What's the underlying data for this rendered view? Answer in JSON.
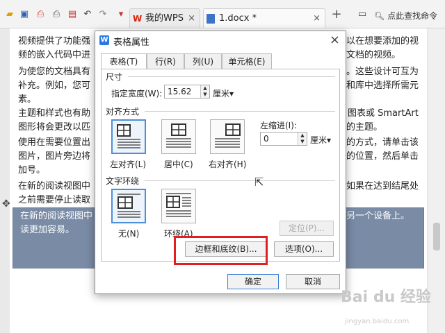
{
  "toolbar": {
    "icons": [
      "open-folder-icon",
      "save-icon",
      "print-preview-icon",
      "print-icon",
      "export-pdf-icon",
      "undo-icon",
      "redo-icon",
      "dropdown-icon"
    ],
    "tabs": [
      {
        "label": "我的WPS",
        "close": "×"
      },
      {
        "label": "1.docx *",
        "close": "×"
      }
    ],
    "new_tab": "+",
    "find_label": "点此查找命令"
  },
  "document": {
    "lines": [
      "视频提供了功能强",
      "频的嵌入代码中进",
      "为使您的文档具有",
      "补充。例如，您可",
      "素。",
      "主题和样式也有助",
      "图形将会更改以匹",
      "使用在需要位置出",
      "图片，图片旁边将",
      "加号。",
      "在新的阅读视图中",
      "之前需要停止读取"
    ],
    "right_lines": [
      "以在想要添加的视",
      "文档的视频。",
      "。这些设计可互为",
      "和库中选择所需元",
      "图表或 SmartArt",
      "的主题。",
      "的方式，请单击该",
      "的位置，然后单击",
      "如果在达到结尾处"
    ],
    "selected_left": [
      "在新的阅读视图中",
      "读更加容易。"
    ],
    "selected_right": "在另一个设备上。"
  },
  "dialog": {
    "title": "表格属性",
    "close": "×",
    "tabs": [
      "表格(T)",
      "行(R)",
      "列(U)",
      "单元格(E)"
    ],
    "size_section": "尺寸",
    "width_label": "指定宽度(W):",
    "width_value": "15.62",
    "width_unit": "厘米▾",
    "align_section": "对齐方式",
    "align_options": [
      "左对齐(L)",
      "居中(C)",
      "右对齐(H)"
    ],
    "indent_label": "左缩进(I):",
    "indent_value": "0",
    "indent_unit": "厘米▾",
    "wrap_section": "文字环绕",
    "wrap_options": [
      "无(N)",
      "环绕(A)"
    ],
    "position_button": "定位(P)...",
    "borders_button": "边框和底纹(B)...",
    "options_button": "选项(O)...",
    "ok_button": "确定",
    "cancel_button": "取消"
  },
  "watermark": {
    "main": "Bai du 经验",
    "sub": "jingyan.baidu.com"
  }
}
